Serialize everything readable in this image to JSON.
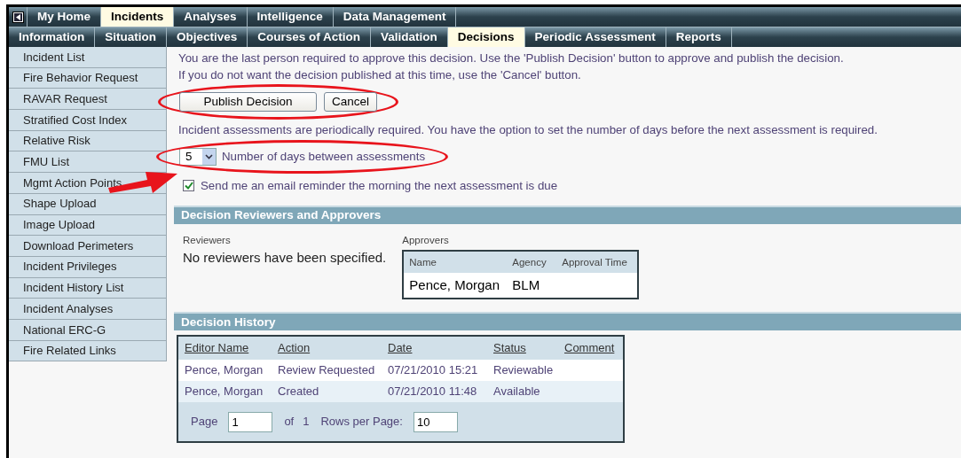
{
  "main_tabs": [
    {
      "label": "My Home",
      "selected": false
    },
    {
      "label": "Incidents",
      "selected": true
    },
    {
      "label": "Analyses",
      "selected": false
    },
    {
      "label": "Intelligence",
      "selected": false
    },
    {
      "label": "Data Management",
      "selected": false
    }
  ],
  "sub_tabs": [
    {
      "label": "Information",
      "selected": false
    },
    {
      "label": "Situation",
      "selected": false
    },
    {
      "label": "Objectives",
      "selected": false
    },
    {
      "label": "Courses of Action",
      "selected": false
    },
    {
      "label": "Validation",
      "selected": false
    },
    {
      "label": "Decisions",
      "selected": true
    },
    {
      "label": "Periodic Assessment",
      "selected": false
    },
    {
      "label": "Reports",
      "selected": false
    }
  ],
  "sidebar": {
    "items": [
      "Incident List",
      "Fire Behavior Request",
      "RAVAR Request",
      "Stratified Cost Index",
      "Relative Risk",
      "FMU List",
      "Mgmt Action Points",
      "Shape Upload",
      "Image Upload",
      "Download Perimeters",
      "Incident Privileges",
      "Incident History List",
      "Incident Analyses",
      "National ERC-G",
      "Fire Related Links"
    ]
  },
  "approval_message": [
    "You are the last person required to approve this decision. Use the 'Publish Decision' button to approve and publish the decision.",
    "If you do not want the decision published at this time, use the 'Cancel' button."
  ],
  "buttons": [
    "Publish Decision",
    "Cancel"
  ],
  "assessment_note": "Incident assessments are periodically required. You have the option to set the number of days before the next assessment is required.",
  "days_select": {
    "value": "5",
    "label": "Number of days between assessments"
  },
  "email_reminder": {
    "label": "Send me an email reminder the morning the next assessment is due",
    "checked": true
  },
  "reviewers_section": {
    "title": "Decision Reviewers and Approvers",
    "reviewers_label": "Reviewers",
    "reviewers_text": "No reviewers have been specified.",
    "approvers_label": "Approvers",
    "columns": [
      "Name",
      "Agency",
      "Approval Time"
    ],
    "rows": [
      [
        "Pence, Morgan",
        "BLM",
        ""
      ]
    ]
  },
  "history_section": {
    "title": "Decision History",
    "columns": [
      "Editor Name",
      "Action",
      "Date",
      "Status",
      "Comment"
    ],
    "rows": [
      [
        "Pence, Morgan",
        "Review Requested",
        "07/21/2010 15:21",
        "Reviewable",
        ""
      ],
      [
        "Pence, Morgan",
        "Created",
        "07/21/2010 11:48",
        "Available",
        ""
      ]
    ],
    "pager": {
      "page_label": "Page",
      "page": "1",
      "of_label": "of",
      "total": "1",
      "rows_label": "Rows per Page:",
      "rows_per_page": "10"
    }
  }
}
